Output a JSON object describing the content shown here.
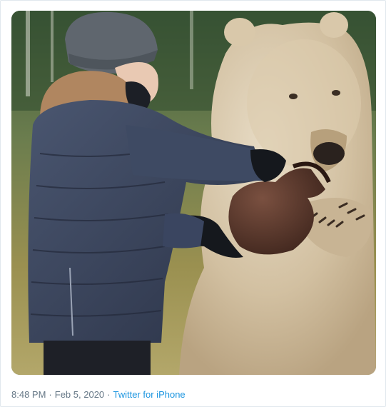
{
  "tweet": {
    "time": "8:48 PM",
    "separator_1": "·",
    "date": "Feb 5, 2020",
    "separator_2": "·",
    "source": "Twitter for iPhone",
    "source_color": "#1b95e0",
    "meta_color": "#657786"
  },
  "media": {
    "type": "video-frame",
    "icon": "photo-media"
  }
}
